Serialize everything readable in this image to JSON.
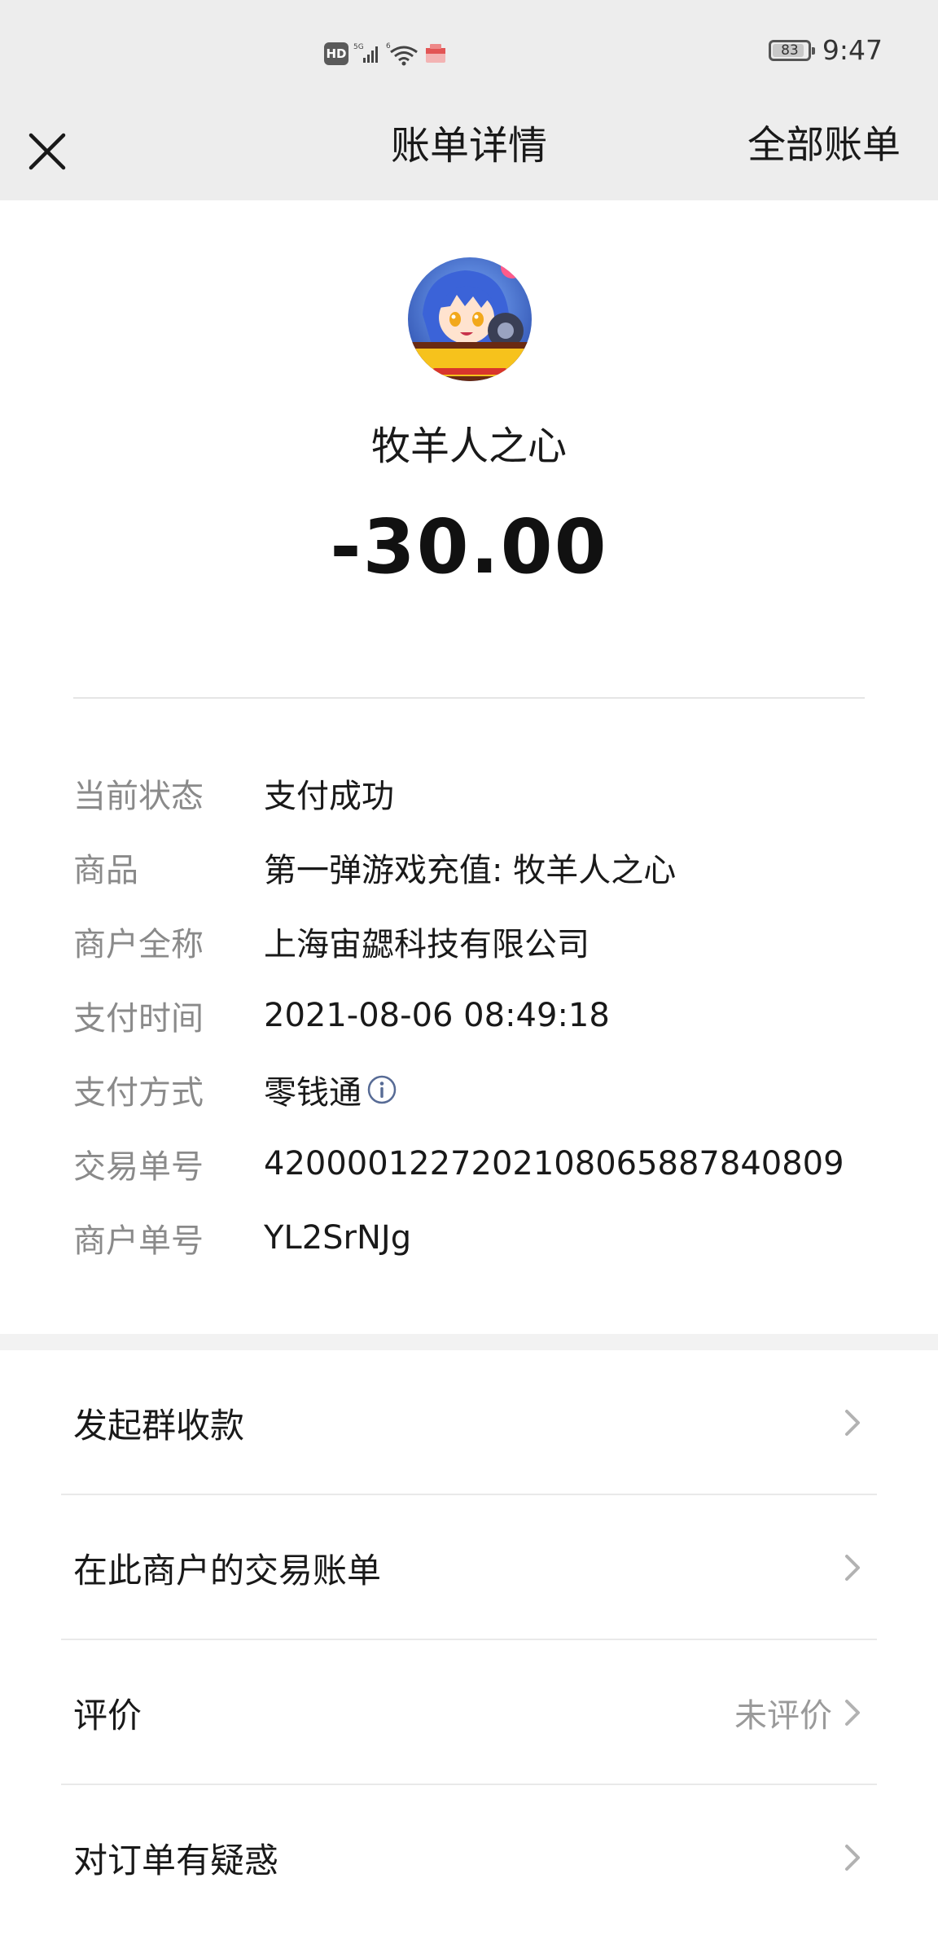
{
  "status_bar": {
    "hd_label": "HD",
    "network_1": "5G",
    "network_2": "6",
    "battery_level": "83",
    "time": "9:47"
  },
  "nav": {
    "title": "账单详情",
    "right_link": "全部账单"
  },
  "header": {
    "merchant_name": "牧羊人之心",
    "amount": "-30.00"
  },
  "details": {
    "rows": [
      {
        "label": "当前状态",
        "value": "支付成功"
      },
      {
        "label": "商品",
        "value": "第一弹游戏充值: 牧羊人之心"
      },
      {
        "label": "商户全称",
        "value": "上海宙勰科技有限公司"
      },
      {
        "label": "支付时间",
        "value": "2021-08-06 08:49:18"
      },
      {
        "label": "支付方式",
        "value": "零钱通"
      },
      {
        "label": "交易单号",
        "value": "4200001227202108065887840809"
      },
      {
        "label": "商户单号",
        "value": "YL2SrNJg"
      }
    ]
  },
  "actions": [
    {
      "label": "发起群收款",
      "extra": ""
    },
    {
      "label": "在此商户的交易账单",
      "extra": ""
    },
    {
      "label": "评价",
      "extra": "未评价"
    },
    {
      "label": "对订单有疑惑",
      "extra": ""
    }
  ],
  "icons": {
    "close": "close-icon",
    "info": "info-icon",
    "chevron": "chevron-right-icon"
  },
  "colors": {
    "nav_bg": "#ededed",
    "label_gray": "#8a8a8a",
    "info_blue": "#576b95"
  }
}
